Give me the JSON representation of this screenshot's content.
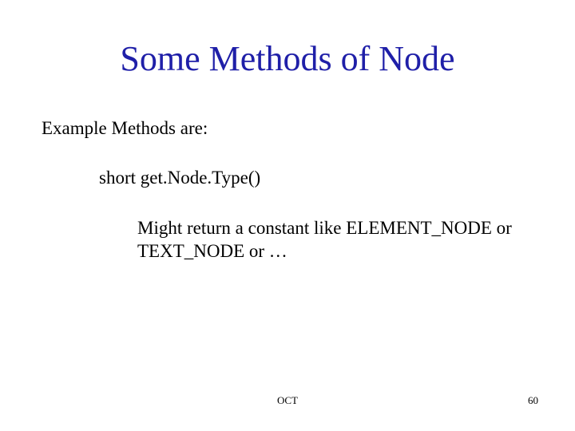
{
  "slide": {
    "title": "Some Methods of Node",
    "subhead": "Example Methods are:",
    "method_signature": "short get.Node.Type()",
    "method_description": " Might return a constant like ELEMENT_NODE or TEXT_NODE or …",
    "footer_center": "OCT",
    "page_number": "60"
  }
}
